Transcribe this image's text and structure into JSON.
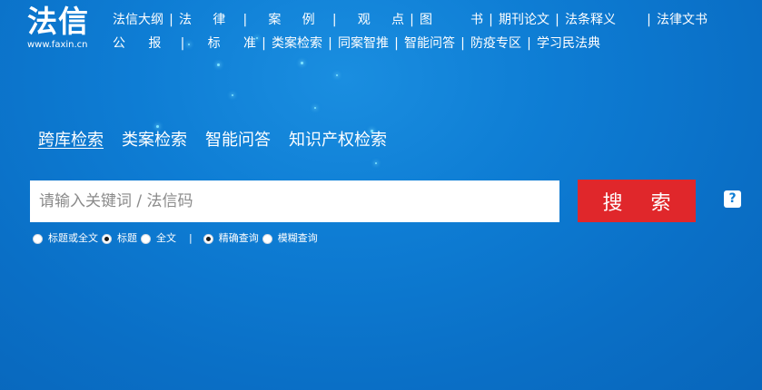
{
  "logo": {
    "mark": "法信",
    "url": "www.faxin.cn"
  },
  "nav": {
    "row1": [
      {
        "label": "法信大纲"
      },
      {
        "label": "法律案例观点"
      },
      {
        "label": "图书"
      },
      {
        "label": "期刊论文"
      },
      {
        "label": "法条释义"
      },
      {
        "label": "法律文书"
      }
    ],
    "row2": [
      {
        "label": "公报标准"
      },
      {
        "label": "类案检索"
      },
      {
        "label": "同案智推"
      },
      {
        "label": "智能问答"
      },
      {
        "label": "防疫专区"
      },
      {
        "label": "学习民法典"
      }
    ]
  },
  "tabs": [
    {
      "label": "跨库检索",
      "active": true
    },
    {
      "label": "类案检索",
      "active": false
    },
    {
      "label": "智能问答",
      "active": false
    },
    {
      "label": "知识产权检索",
      "active": false
    }
  ],
  "search": {
    "placeholder": "请输入关键词 / 法信码",
    "value": "",
    "button_label": "搜 索",
    "help_label": "?"
  },
  "options": {
    "scope": [
      {
        "label": "标题或全文",
        "checked": false
      },
      {
        "label": "标题",
        "checked": true
      },
      {
        "label": "全文",
        "checked": false
      }
    ],
    "separator": "|",
    "mode": [
      {
        "label": "精确查询",
        "checked": true
      },
      {
        "label": "模糊查询",
        "checked": false
      }
    ]
  },
  "colors": {
    "background": "#0e7dd4",
    "search_button": "#e0272b"
  }
}
